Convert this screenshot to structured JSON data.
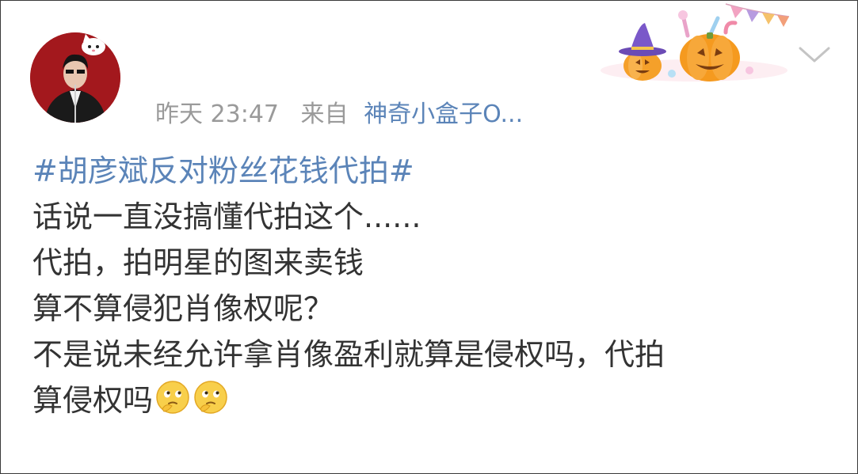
{
  "post": {
    "time": "昨天 23:47",
    "from_label": "来自",
    "source": "神奇小盒子O...",
    "hashtag": "#胡彦斌反对粉丝花钱代拍#",
    "lines": [
      "话说一直没搞懂代拍这个......",
      "代拍，拍明星的图来卖钱",
      "算不算侵犯肖像权呢？",
      "不是说未经允许拿肖像盈利就算是侵权吗，代拍",
      "算侵权吗"
    ],
    "emojis": [
      "thinking-emoji",
      "thinking-emoji"
    ]
  },
  "icons": {
    "avatar": "user-avatar",
    "decoration": "halloween-pumpkin-candy-decoration",
    "menu": "chevron-down-icon"
  },
  "colors": {
    "link": "#5b84b8",
    "meta": "#9a9a9a",
    "text": "#333333",
    "avatar_bg": "#a3181d"
  }
}
